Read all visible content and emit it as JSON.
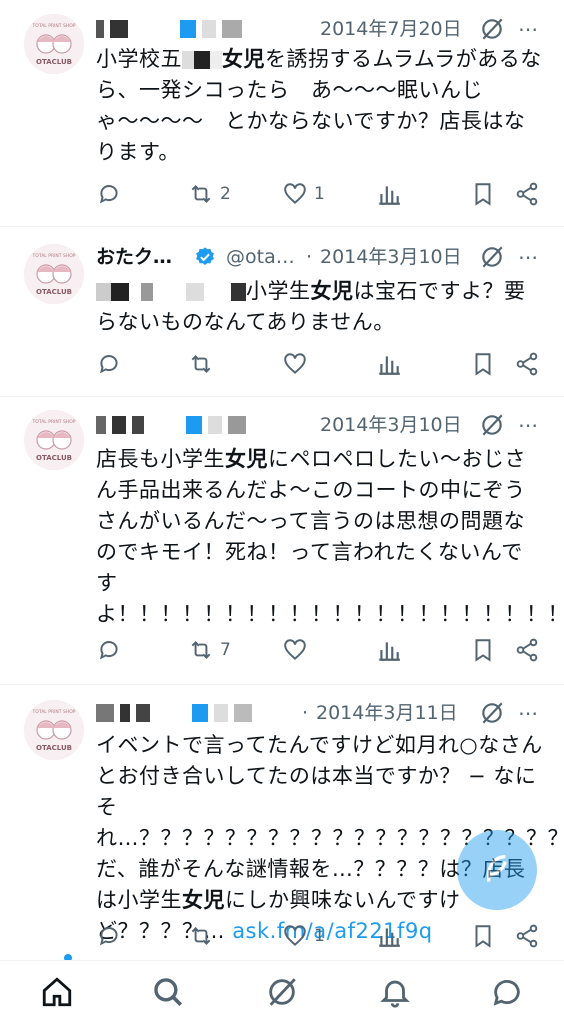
{
  "tweets": [
    {
      "name": "",
      "handle": "",
      "date": "2014年7月20日",
      "text_parts": [
        "小学校五",
        "",
        "女児",
        "を誘拐するムラムラがあるなら、一発シコったら　あ〜〜〜眠いんじゃ〜〜〜〜　とかならないですか？店長はなります。"
      ],
      "reply": "",
      "retweet": "2",
      "like": "1"
    },
    {
      "name": "おたク…",
      "handle": "@ota…",
      "date": "2014年3月10日",
      "text_parts": [
        "小学生",
        "女児",
        "は宝石ですよ？要らないものなんてありません。"
      ],
      "reply": "",
      "retweet": "",
      "like": ""
    },
    {
      "name": "",
      "handle": "",
      "date": "2014年3月10日",
      "text_parts": [
        "店長も小学生",
        "女児",
        "にペロペロしたい〜おじさん手品出来るんだよ〜このコートの中にぞうさんがいるんだ〜って言うのは思想の問題なのでキモイ！死ね！って言われたくないんですよ！！！！！！！！！！！！！！！！！！！！！！！！！！！！！！！！！！！！！！！！！"
      ],
      "reply": "",
      "retweet": "7",
      "like": ""
    },
    {
      "name": "",
      "handle": "",
      "date": "2014年3月11日",
      "text_parts": [
        "イベントで言ってたんですけど如月れ○なさんとお付き合いしてたのは本当ですか？ − なにそれ…？？？？？？？？？？？？？？？？？？？？？？？？？？？だ、誰がそんな謎情報を…？？？？は？店長は小学生",
        "女児",
        "にしか興味ないんですけど？？？？… "
      ],
      "link": "ask.fm/a/af221f9q",
      "reply": "",
      "retweet": "",
      "like": "1"
    }
  ],
  "avatar_text": "OTACLUB",
  "avatar_arc_text": "TOTAL PRINT SHOP",
  "colors": {
    "accent": "#1d9bf0",
    "text": "#0f1419",
    "muted": "#536471",
    "divider": "#eff3f4"
  },
  "icons": {
    "reply": "speech-bubble-icon",
    "retweet": "retweet-icon",
    "like": "heart-icon",
    "views": "bar-chart-icon",
    "bookmark": "bookmark-icon",
    "share": "share-icon",
    "grok": "grok-icon",
    "more": "more-dots-icon",
    "compose": "compose-feather-icon"
  },
  "tabbar": [
    "home-icon",
    "search-icon",
    "grok-icon",
    "bell-icon",
    "messages-icon"
  ]
}
